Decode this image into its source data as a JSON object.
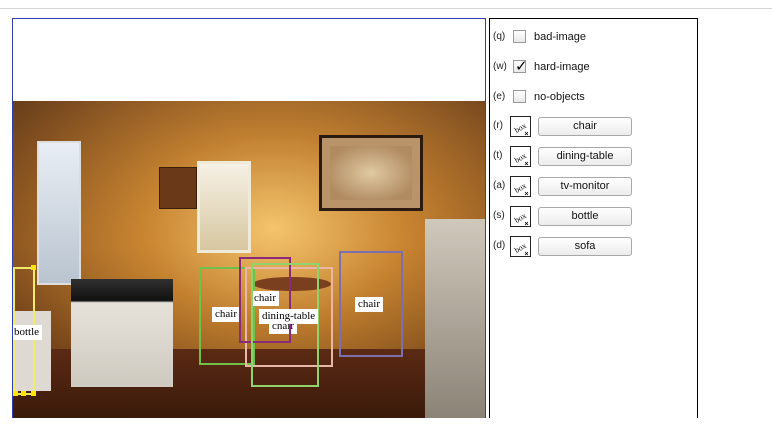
{
  "flags": [
    {
      "key": "(q)",
      "label": "bad-image",
      "checked": false
    },
    {
      "key": "(w)",
      "label": "hard-image",
      "checked": true
    },
    {
      "key": "(e)",
      "label": "no-objects",
      "checked": false
    }
  ],
  "check_glyph": "✓",
  "box_icon_text": "box",
  "categories": [
    {
      "key": "(r)",
      "label": "chair"
    },
    {
      "key": "(t)",
      "label": "dining-table"
    },
    {
      "key": "(a)",
      "label": "tv-monitor"
    },
    {
      "key": "(s)",
      "label": "bottle"
    },
    {
      "key": "(d)",
      "label": "sofa"
    }
  ],
  "annotations": [
    {
      "label": "chair",
      "color": "#6ec24a"
    },
    {
      "label": "chair",
      "color": "#8a2a7a"
    },
    {
      "label": "chair",
      "color": "#e9b7a8"
    },
    {
      "label": "dining-table",
      "color": "#8fd46a"
    },
    {
      "label": "chair",
      "color": "#7b6fb0"
    },
    {
      "label": "bottle",
      "color": "#f0ec6a"
    }
  ],
  "colors": {
    "canvas_border": "#2f3fb0",
    "panel_border": "#000000",
    "handle": "#ffe400"
  }
}
